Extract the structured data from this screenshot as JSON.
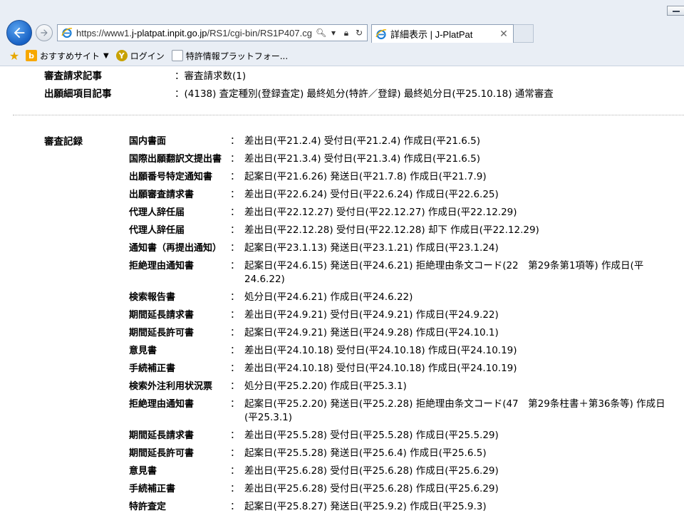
{
  "browser": {
    "url": "https://www1.j-platpat.inpit.go.jp/RS1/cgi-bin/RS1P407.cg",
    "url_scheme": "https://www1.",
    "url_host": "j-platpat.inpit.go.jp",
    "url_path": "/RS1/cgi-bin/RS1P407.cg",
    "tab_title": "詳細表示 | J-PlatPat",
    "favorites": [
      {
        "label": "おすすめサイト",
        "icon": "bing-icon"
      },
      {
        "label": "ログイン",
        "icon": "yahoo-icon"
      },
      {
        "label": "特許情報プラットフォー...",
        "icon": "page-icon"
      }
    ],
    "accent": "#1761c4"
  },
  "meta": [
    {
      "label": "審査請求記事",
      "value": "：審査請求数(1)"
    },
    {
      "label": "出願細項目記事",
      "value": "：(4138) 査定種別(登録査定) 最終処分(特許／登録) 最終処分日(平25.10.18) 通常審査"
    }
  ],
  "exam_heading": "審査記録",
  "colon": "：",
  "records": [
    {
      "name": "国内書面",
      "detail": "差出日(平21.2.4) 受付日(平21.2.4) 作成日(平21.6.5)"
    },
    {
      "name": "国際出願翻訳文提出書",
      "detail": "差出日(平21.3.4) 受付日(平21.3.4) 作成日(平21.6.5)"
    },
    {
      "name": "出願番号特定通知書",
      "detail": "起案日(平21.6.26) 発送日(平21.7.8) 作成日(平21.7.9)"
    },
    {
      "name": "出願審査請求書",
      "detail": "差出日(平22.6.24) 受付日(平22.6.24) 作成日(平22.6.25)"
    },
    {
      "name": "代理人辞任届",
      "detail": "差出日(平22.12.27) 受付日(平22.12.27) 作成日(平22.12.29)"
    },
    {
      "name": "代理人辞任届",
      "detail": "差出日(平22.12.28) 受付日(平22.12.28) 却下 作成日(平22.12.29)"
    },
    {
      "name": "通知書（再提出通知）",
      "detail": "起案日(平23.1.13) 発送日(平23.1.21) 作成日(平23.1.24)"
    },
    {
      "name": "拒絶理由通知書",
      "detail": "起案日(平24.6.15) 発送日(平24.6.21) 拒絶理由条文コード(22　第29条第1項等) 作成日(平24.6.22)"
    },
    {
      "name": "検索報告書",
      "detail": "処分日(平24.6.21) 作成日(平24.6.22)"
    },
    {
      "name": "期間延長請求書",
      "detail": "差出日(平24.9.21) 受付日(平24.9.21) 作成日(平24.9.22)"
    },
    {
      "name": "期間延長許可書",
      "detail": "起案日(平24.9.21) 発送日(平24.9.28) 作成日(平24.10.1)"
    },
    {
      "name": "意見書",
      "detail": "差出日(平24.10.18) 受付日(平24.10.18) 作成日(平24.10.19)"
    },
    {
      "name": "手続補正書",
      "detail": "差出日(平24.10.18) 受付日(平24.10.18) 作成日(平24.10.19)"
    },
    {
      "name": "検索外注利用状況票",
      "detail": "処分日(平25.2.20) 作成日(平25.3.1)"
    },
    {
      "name": "拒絶理由通知書",
      "detail": "起案日(平25.2.20) 発送日(平25.2.28) 拒絶理由条文コード(47　第29条柱書＋第36条等) 作成日(平25.3.1)"
    },
    {
      "name": "期間延長請求書",
      "detail": "差出日(平25.5.28) 受付日(平25.5.28) 作成日(平25.5.29)"
    },
    {
      "name": "期間延長許可書",
      "detail": "起案日(平25.5.28) 発送日(平25.6.4) 作成日(平25.6.5)"
    },
    {
      "name": "意見書",
      "detail": "差出日(平25.6.28) 受付日(平25.6.28) 作成日(平25.6.29)"
    },
    {
      "name": "手続補正書",
      "detail": "差出日(平25.6.28) 受付日(平25.6.28) 作成日(平25.6.29)"
    },
    {
      "name": "特許査定",
      "detail": "起案日(平25.8.27) 発送日(平25.9.2) 作成日(平25.9.3)"
    }
  ]
}
